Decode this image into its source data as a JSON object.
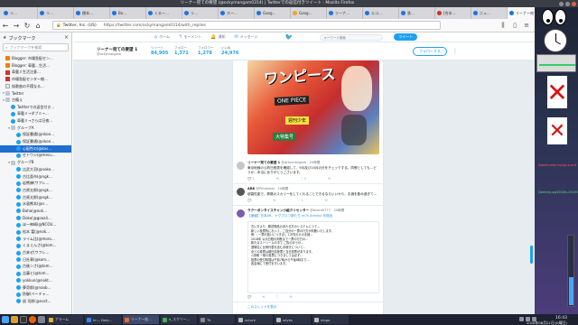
{
  "window": {
    "title": "リーナー宛ての要望 (@ockymangam0314) | Twitterでの返信付きツイート - Mozilla Firefox"
  },
  "tabs": [
    {
      "label": "リ…",
      "color": "blue"
    },
    {
      "label": "リ…",
      "color": "blue"
    },
    {
      "label": "標本…",
      "color": "blue"
    },
    {
      "label": "Bo…",
      "color": "blue"
    },
    {
      "label": "くるー…",
      "color": "blue"
    },
    {
      "label": "リ…",
      "color": "blue"
    },
    {
      "label": "ホー…",
      "color": "blue"
    },
    {
      "label": "Goog…",
      "color": "blue"
    },
    {
      "label": "Goog…",
      "color": "yel"
    },
    {
      "label": "リーナ…",
      "color": "blue"
    },
    {
      "label": "エコ…",
      "color": "blue"
    },
    {
      "label": "鉄…",
      "color": "blue"
    },
    {
      "label": "[合本…",
      "color": "red"
    },
    {
      "label": "ニュ…",
      "color": "blue"
    },
    {
      "label": "リーナー宛て…",
      "color": "blue",
      "active": true
    }
  ],
  "navbar": {
    "host": "Twitter, Inc. (US)",
    "url": "https://twitter.com/ockymangam0314/with_replies"
  },
  "sidebar": {
    "title": "ブックマーク",
    "search_placeholder": "ブックマークを検索",
    "items": [
      {
        "indent": 0,
        "icon": "blog",
        "label": "Blogger: 市場急配セン…"
      },
      {
        "indent": 0,
        "icon": "blog",
        "label": "Blogger: 車載…生活…"
      },
      {
        "indent": 0,
        "icon": "red",
        "label": "車載ミ生活注意…"
      },
      {
        "indent": 0,
        "icon": "red",
        "label": "市場急配センター総…"
      },
      {
        "indent": 0,
        "icon": "doc",
        "label": "仮歌曲の不穏なる…"
      },
      {
        "indent": 0,
        "icon": "folder",
        "label": "Twitter"
      },
      {
        "indent": 0,
        "icon": "folder",
        "label": "古備え"
      },
      {
        "indent": 1,
        "icon": "tw",
        "label": "Twitterでの返信付き…"
      },
      {
        "indent": 1,
        "icon": "tw",
        "label": "車載ミ→ダブミ→…"
      },
      {
        "indent": 1,
        "icon": "tw",
        "label": "車載ミ→さらば日夜…"
      },
      {
        "indent": 1,
        "icon": "folder",
        "label": "グループA"
      },
      {
        "indent": 2,
        "icon": "tw",
        "label": "保証書通(@nkon…"
      },
      {
        "indent": 2,
        "icon": "tw",
        "label": "保証書通(@nkon…"
      },
      {
        "indent": 2,
        "icon": "tw",
        "label": "心配性の(@kos…",
        "selected": true
      },
      {
        "indent": 2,
        "icon": "tw",
        "label": "セトウシ(@mecu…"
      },
      {
        "indent": 1,
        "icon": "folder",
        "label": "グループB"
      },
      {
        "indent": 2,
        "icon": "tw",
        "label": "吉武大羽(@noke…"
      },
      {
        "indent": 2,
        "icon": "tw",
        "label": "古比亜市(@ngk…"
      },
      {
        "indent": 2,
        "icon": "tw",
        "label": "岩熊練(ワフレ…"
      },
      {
        "indent": 2,
        "icon": "tw",
        "label": "古原太郎(@ngk…"
      },
      {
        "indent": 2,
        "icon": "tw",
        "label": "古原太郎(@ngk…"
      },
      {
        "indent": 2,
        "icon": "tw",
        "label": "水島熊本(@n…"
      },
      {
        "indent": 2,
        "icon": "tw",
        "label": "Baho(@nok…"
      },
      {
        "indent": 2,
        "icon": "tw",
        "label": "Doko(@gooali…"
      },
      {
        "indent": 2,
        "icon": "tw",
        "label": "ほー神崎(@NCOU…"
      },
      {
        "indent": 2,
        "icon": "tw",
        "label": "松本 富(@nok…"
      },
      {
        "indent": 2,
        "icon": "tw",
        "label": "ライム比(@moro…"
      },
      {
        "indent": 2,
        "icon": "tw",
        "label": "くまぇんさ(@tom…"
      },
      {
        "indent": 2,
        "icon": "tw",
        "label": "古来ぜ(ワフレ…"
      },
      {
        "indent": 2,
        "icon": "tw",
        "label": "日社専(@kom…"
      },
      {
        "indent": 2,
        "icon": "tw",
        "label": "古後ンさ(@tom…"
      },
      {
        "indent": 2,
        "icon": "tw",
        "label": "吉藤ヒ(@tom…"
      },
      {
        "indent": 2,
        "icon": "tw",
        "label": "yokkun(@nokt…"
      },
      {
        "indent": 2,
        "icon": "tw",
        "label": "夢奇郎(@noob…"
      },
      {
        "indent": 2,
        "icon": "tw",
        "label": "防御(ベーチャ…"
      },
      {
        "indent": 2,
        "icon": "tw",
        "label": "鼠 司郎(@noct…"
      }
    ]
  },
  "twitter": {
    "nav": [
      {
        "icon": "⌂",
        "label": "ホーム"
      },
      {
        "icon": "ϟ",
        "label": "モーメント"
      },
      {
        "icon": "🔔",
        "label": "通知"
      },
      {
        "icon": "✉",
        "label": "メッセージ"
      }
    ],
    "search_placeholder": "キーワード検索",
    "tweet_button": "ツイート",
    "profile": {
      "name": "リーナー宛ての要望 1",
      "handle": "@ockymangam",
      "stats": [
        {
          "label": "ツイート",
          "value": "84,905"
        },
        {
          "label": "フォロー",
          "value": "1,371"
        },
        {
          "label": "フォロワー",
          "value": "1,278"
        },
        {
          "label": "いいね",
          "value": "24,976"
        }
      ],
      "follow_button": "フォローする"
    },
    "magazine": {
      "title": "ワンピース",
      "band1": "ONE PIECE",
      "band2": "週刊少年",
      "band3": "大特集号"
    },
    "tweets": [
      {
        "name": "リーナー宛ての要望 1",
        "handle": "@ockymangam",
        "time": "20時間",
        "body": "東京地裁の公判日程表を確認して、9月及び10月の分をチェックする。同僚としても…どうか…本当にありがとうございます。",
        "replies": "1",
        "retweets": "",
        "likes": "2"
      },
      {
        "name": "ARK",
        "handle": "@Pinokoshi",
        "time": "20時間",
        "body": "超高性能で、夢路のスカリー化してくれることできるならいいから、お酒を飲み過ぎて…",
        "replies": "",
        "retweets": "",
        "likes": "1"
      },
      {
        "name": "ラクーポンタイスチャン小組クリセンター",
        "handle": "@bcom0777",
        "time": "20時間",
        "body": "【速報】日本AR。ナグプロフ新たち nt7s Arinikul を検出",
        "quoted": [
          "古い方より、郵送物品のあたる方のシステムにつて…",
          "新しい投票所において、ご自分の一票の行方が判断いたします。",
          "例:  ',  一票の扱いにつきましてお知らせの手続…",
          "2018年 公示日程の判断まで一票の行方の…",
          "新たなストリームの中で ご覧のほうの…",
          "選挙区に比例代表を含む手続きについて…",
          "全ての投票は期日前投票と当日投票があります。",
          "◇詳細 一般の投票につきましては必ず…",
          "投票の受付時間は午前7時から午後8時まで…",
          "各会場にて受付を行います。"
        ],
        "replies": "",
        "retweets": "",
        "likes": ""
      }
    ],
    "show_convo": "このスレッドを表示"
  },
  "desktop": {
    "label_red": "Sweet-add-mysql-sua.tl",
    "label_green": "Gemmy-sql2018n-20191"
  },
  "taskbar": {
    "tasks": [
      {
        "label": "アラーム",
        "color": "#e6b325"
      },
      {
        "label": "hr— Dolp…",
        "color": "#3b82f6"
      },
      {
        "label": "リーナー宛…",
        "color": "#e8692a",
        "active": true
      },
      {
        "label": "a_スクリー…",
        "color": "#4caf50"
      },
      {
        "label": "Tk",
        "color": "#888888"
      },
      {
        "label": "xclock",
        "color": "#bbbbbb"
      },
      {
        "label": "xeyes",
        "color": "#bbbbbb"
      },
      {
        "label": "xlogo",
        "color": "#bbbbbb"
      }
    ],
    "time": "16:43",
    "date": "2018年08月21日(火曜日)"
  }
}
